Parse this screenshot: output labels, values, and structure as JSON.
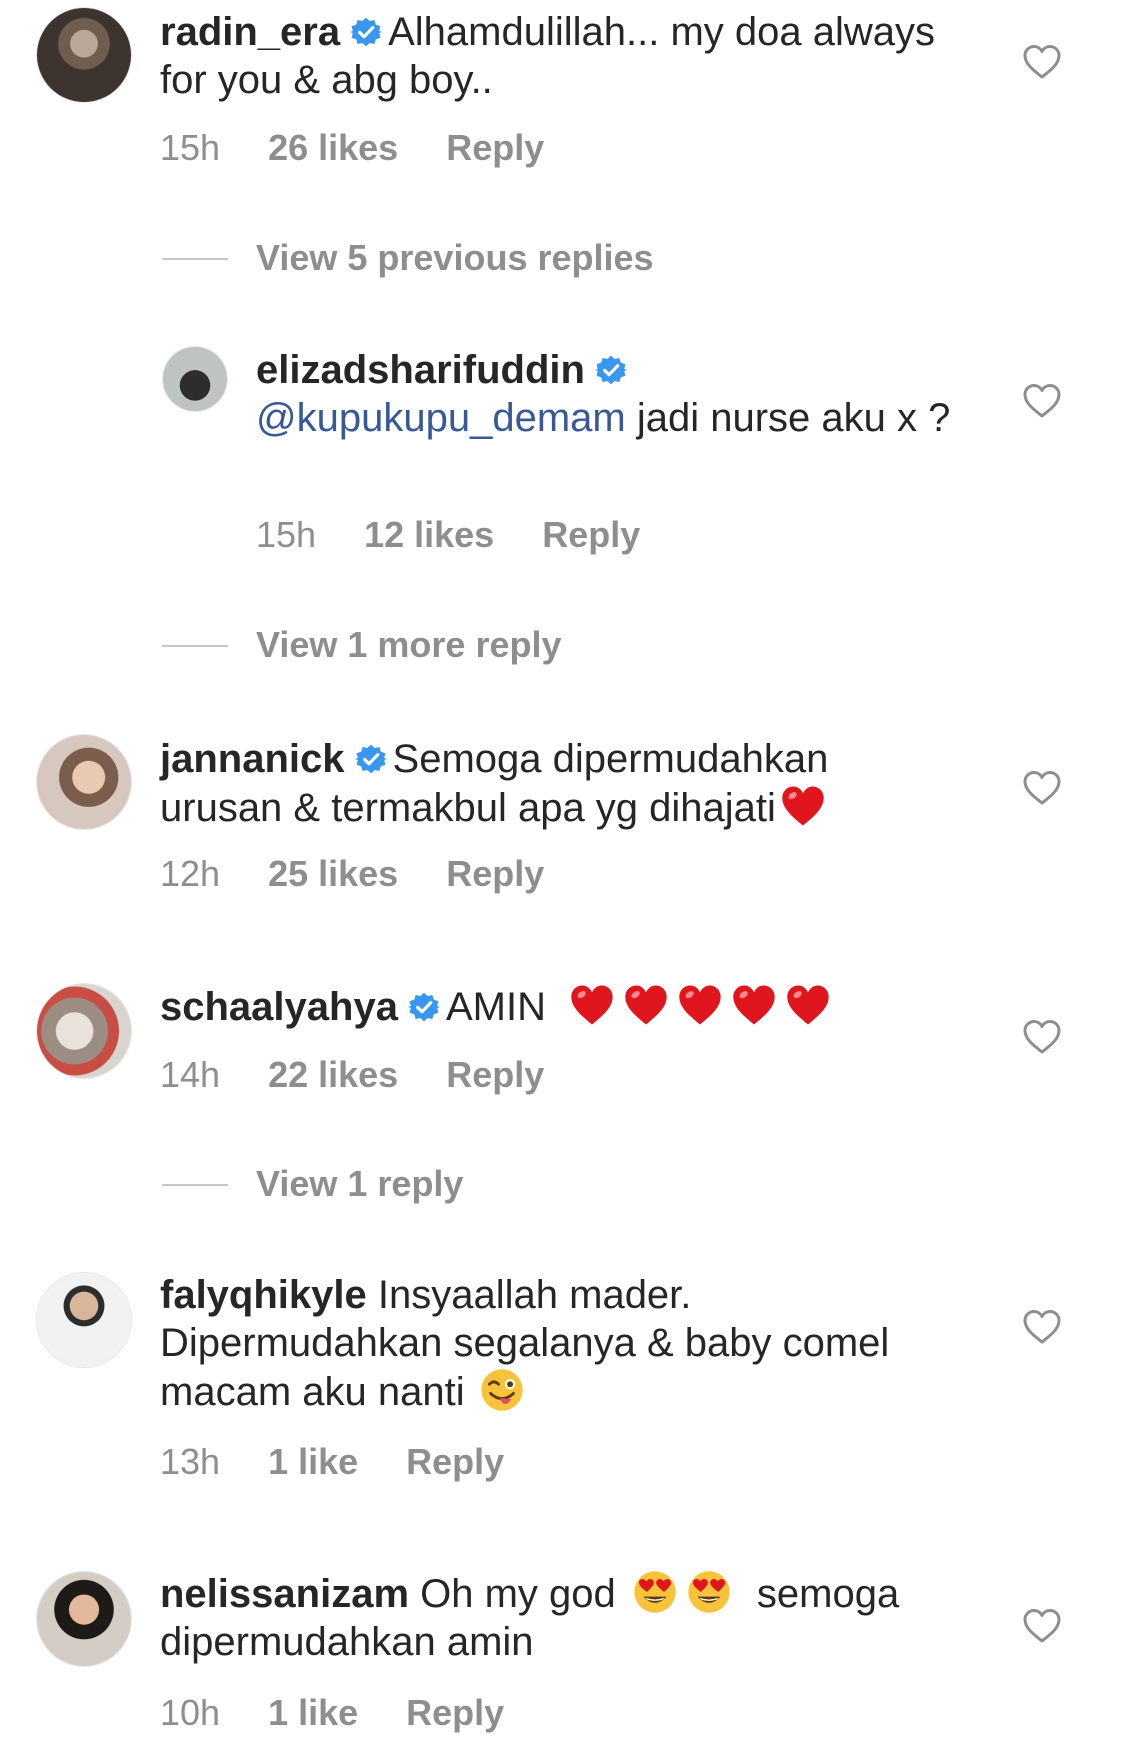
{
  "comments": [
    {
      "username": "radin_era",
      "text": "Alhamdulillah... my doa always for you & abg boy..",
      "time": "15h",
      "likes": "26 likes",
      "reply": "Reply"
    },
    {
      "view_more": "View 5 previous replies"
    },
    {
      "username": "elizadsharifuddin",
      "mention": "@kupukupu_demam",
      "text": " jadi nurse aku x ?",
      "time": "15h",
      "likes": "12 likes",
      "reply": "Reply"
    },
    {
      "view_more": "View 1 more reply"
    },
    {
      "username": "jannanick",
      "text": "Semoga dipermudahkan urusan & termakbul apa yg dihajati",
      "time": "12h",
      "likes": "25 likes",
      "reply": "Reply"
    },
    {
      "username": "schaalyahya",
      "text": "AMIN",
      "time": "14h",
      "likes": "22 likes",
      "reply": "Reply"
    },
    {
      "view_more": "View 1 reply"
    },
    {
      "username": "falyqhikyle",
      "text": "Insyaallah mader. Dipermudahkan segalanya & baby comel macam aku nanti",
      "time": "13h",
      "likes": "1 like",
      "reply": "Reply"
    },
    {
      "username": "nelissanizam",
      "text_a": "Oh my god",
      "text_b": "semoga dipermudahkan amin",
      "time": "10h",
      "likes": "1 like",
      "reply": "Reply"
    }
  ],
  "icons": {
    "like": "heart-outline-icon",
    "verified": "verified-badge-icon",
    "emoji_heart": "red-heart-emoji",
    "emoji_wink_tongue": "winking-face-tongue-emoji",
    "emoji_heart_eyes": "heart-eyes-emoji"
  },
  "colors": {
    "text": "#262626",
    "secondary": "#8e8e8e",
    "mention": "#385898",
    "verified": "#3897f0",
    "heart_emoji": "#e0161f"
  }
}
